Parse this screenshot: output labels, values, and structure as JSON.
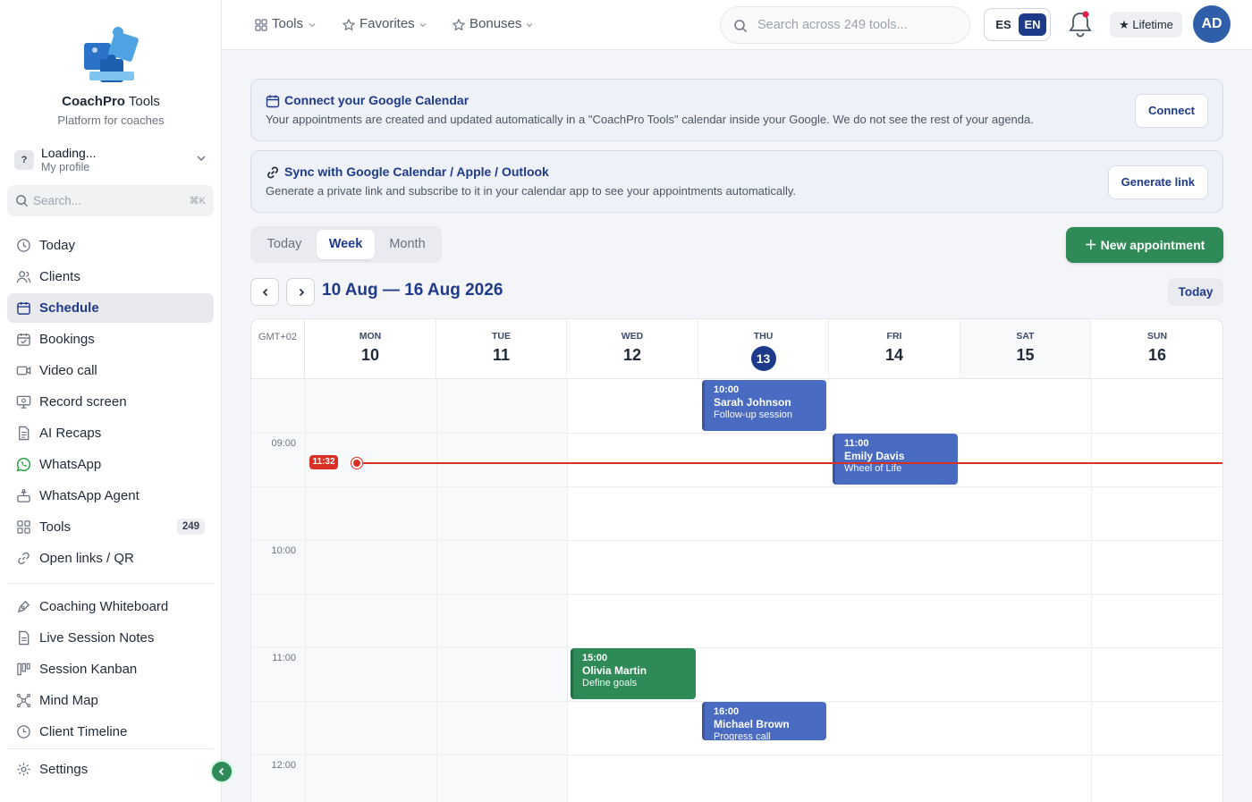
{
  "brand": {
    "name_bold": "CoachPro",
    "name_rest": " Tools",
    "tagline": "Platform for coaches"
  },
  "profile": {
    "badge": "?",
    "name": "Loading...",
    "subtitle": "My profile"
  },
  "sidebar_search": {
    "placeholder": "Search...",
    "shortcut": "⌘K"
  },
  "sidebar": {
    "items": [
      {
        "label": "Today",
        "icon": "clock-icon"
      },
      {
        "label": "Clients",
        "icon": "users-icon"
      },
      {
        "label": "Schedule",
        "icon": "calendar-icon",
        "active": true
      },
      {
        "label": "Bookings",
        "icon": "calendar-check-icon"
      },
      {
        "label": "Video call",
        "icon": "video-icon"
      },
      {
        "label": "Record screen",
        "icon": "monitor-icon"
      },
      {
        "label": "AI Recaps",
        "icon": "file-text-icon"
      },
      {
        "label": "WhatsApp",
        "icon": "whatsapp-icon"
      },
      {
        "label": "WhatsApp Agent",
        "icon": "bot-icon"
      },
      {
        "label": "Tools",
        "icon": "grid-icon",
        "badge": "249"
      },
      {
        "label": "Open links / QR",
        "icon": "link-icon"
      }
    ],
    "tools": [
      {
        "label": "Coaching Whiteboard",
        "icon": "pen-tool-icon"
      },
      {
        "label": "Live Session Notes",
        "icon": "notes-icon"
      },
      {
        "label": "Session Kanban",
        "icon": "kanban-icon"
      },
      {
        "label": "Mind Map",
        "icon": "mind-map-icon"
      },
      {
        "label": "Client Timeline",
        "icon": "history-icon"
      }
    ],
    "settings": "Settings"
  },
  "topbar": {
    "tools": "Tools",
    "favorites": "Favorites",
    "bonuses": "Bonuses",
    "search_placeholder": "Search across 249 tools...",
    "lang_es": "ES",
    "lang_en": "EN",
    "plan": "★ Lifetime",
    "avatar": "AD"
  },
  "banners": {
    "google": {
      "title": "Connect your Google Calendar",
      "desc": "Your appointments are created and updated automatically in a \"CoachPro Tools\" calendar inside your Google. We do not see the rest of your agenda.",
      "button": "Connect"
    },
    "sync": {
      "title": "Sync with Google Calendar / Apple / Outlook",
      "desc": "Generate a private link and subscribe to it in your calendar app to see your appointments automatically.",
      "button": "Generate link"
    }
  },
  "views": {
    "today": "Today",
    "week": "Week",
    "month": "Month",
    "selected": "Week"
  },
  "new_appointment": "New appointment",
  "range": "10 Aug — 16 Aug 2026",
  "today_button": "Today",
  "calendar": {
    "timezone": "GMT+02",
    "days": [
      {
        "name": "MON",
        "date": "10"
      },
      {
        "name": "TUE",
        "date": "11"
      },
      {
        "name": "WED",
        "date": "12"
      },
      {
        "name": "THU",
        "date": "13",
        "today": true
      },
      {
        "name": "FRI",
        "date": "14"
      },
      {
        "name": "SAT",
        "date": "15"
      },
      {
        "name": "SUN",
        "date": "16"
      }
    ],
    "hours": [
      "09:00",
      "10:00",
      "11:00",
      "12:00"
    ],
    "now_label": "11:32",
    "events": [
      {
        "time": "10:00",
        "name": "Sarah Johnson",
        "title": "Follow-up session",
        "color": "#4a6bc2"
      },
      {
        "time": "11:00",
        "name": "Emily Davis",
        "title": "Wheel of Life",
        "color": "#4a6bc2"
      },
      {
        "time": "15:00",
        "name": "Olivia Martin",
        "title": "Define goals",
        "color": "#2e8b57"
      },
      {
        "time": "16:00",
        "name": "Michael Brown",
        "title": "Progress call",
        "color": "#4a6bc2"
      }
    ]
  },
  "colors": {
    "primary": "#1e3a8a",
    "accent_green": "#2e8b57",
    "now_line": "#d93025",
    "event_blue": "#4a6bc2"
  }
}
